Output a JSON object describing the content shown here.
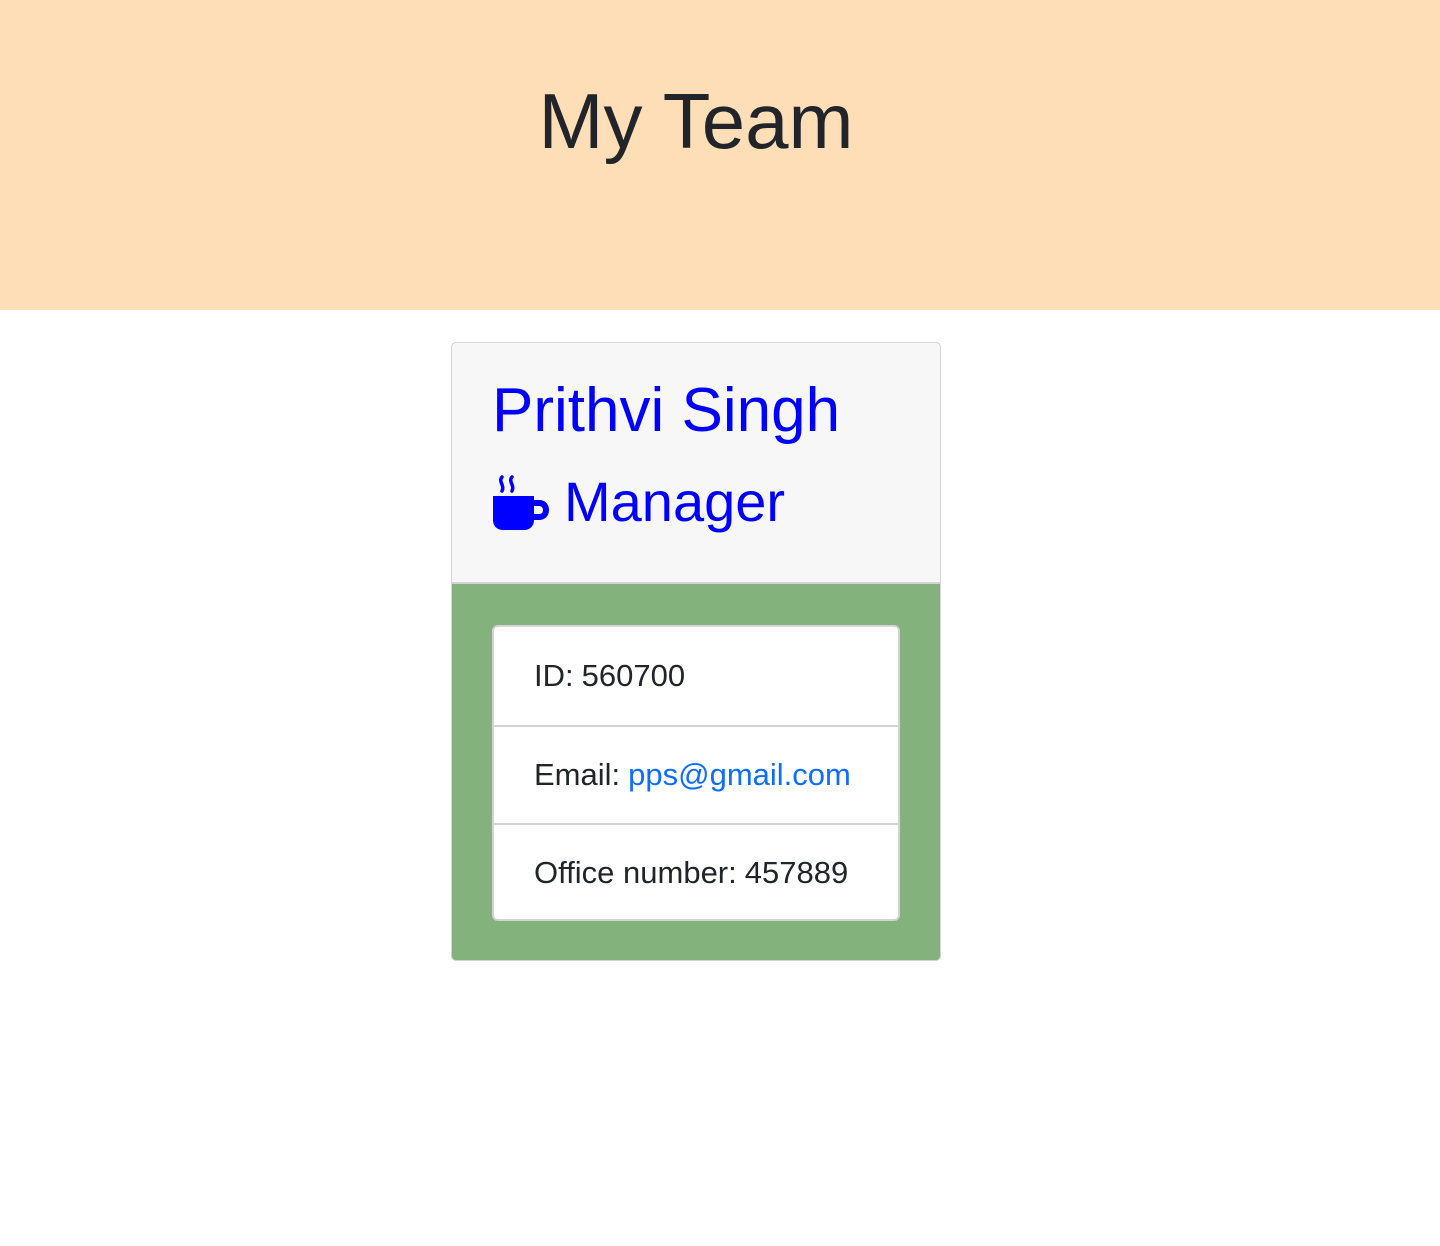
{
  "header": {
    "title": "My Team"
  },
  "employee": {
    "name": "Prithvi Singh",
    "role": "Manager",
    "role_icon": "mug-hot-icon",
    "id_label": "ID:",
    "id_value": "560700",
    "email_label": "Email:",
    "email_value": "pps@gmail.com",
    "office_label": "Office number:",
    "office_value": "457889"
  },
  "colors": {
    "header_bg": "#fddeb7",
    "card_body_bg": "#84b27c",
    "card_header_bg": "#f7f7f7",
    "name_color": "#0000ff",
    "link_color": "#0d6efd"
  }
}
